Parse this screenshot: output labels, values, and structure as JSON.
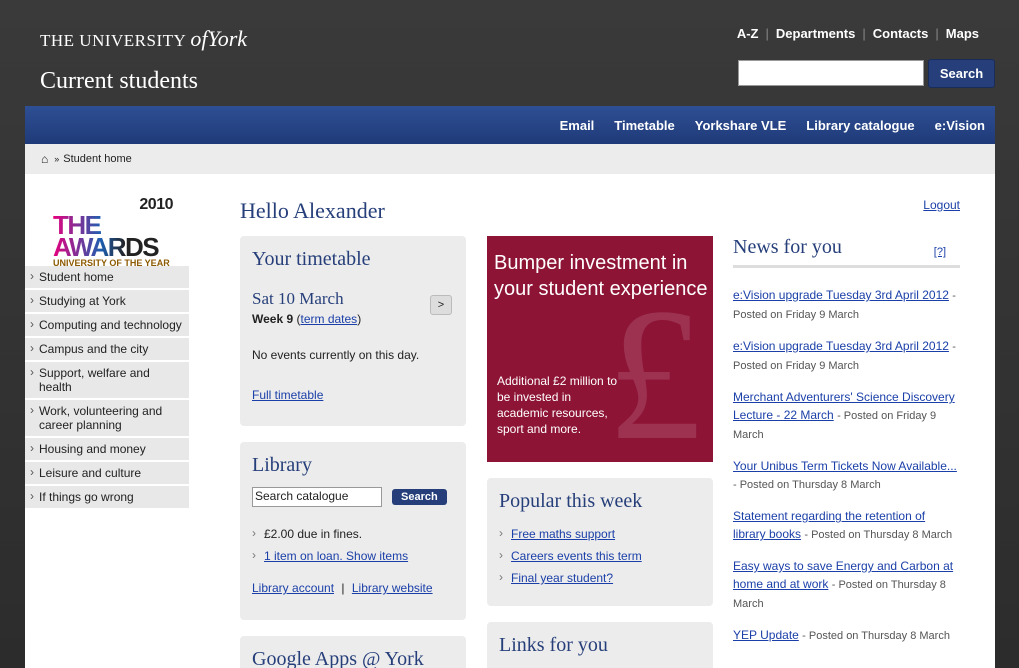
{
  "header": {
    "logo_prefix": "THE UNIVERSITY",
    "logo_of": "of",
    "logo_york": "York",
    "site_title": "Current students",
    "toplinks": [
      "A-Z",
      "Departments",
      "Contacts",
      "Maps"
    ],
    "search_button": "Search"
  },
  "nav": [
    "Email",
    "Timetable",
    "Yorkshare VLE",
    "Library catalogue",
    "e:Vision"
  ],
  "breadcrumb": {
    "home_icon": "home-icon",
    "separator": "»",
    "current": "Student home"
  },
  "awards": {
    "year": "2010",
    "word": "THE AWARDS",
    "sub": "UNIVERSITY OF THE YEAR"
  },
  "sidebar": [
    "Student home",
    "Studying at York",
    "Computing and technology",
    "Campus and the city",
    "Support, welfare and health",
    "Work, volunteering and career planning",
    "Housing and money",
    "Leisure and culture",
    "If things go wrong"
  ],
  "greeting": "Hello Alexander",
  "logout": "Logout",
  "timetable": {
    "title": "Your timetable",
    "date": "Sat 10 March",
    "next": ">",
    "week": "Week 9",
    "term_dates": "term dates",
    "no_events": "No events currently on this day.",
    "full": "Full timetable"
  },
  "library": {
    "title": "Library",
    "placeholder": "Search catalogue",
    "search": "Search",
    "fines": "£2.00 due in fines.",
    "loan": "1 item on loan. Show items",
    "account": "Library account",
    "website": "Library website"
  },
  "google": {
    "title": "Google Apps @ York"
  },
  "promo": {
    "headline": "Bumper investment in your student experience",
    "body": "Additional £2 million to be invested in academic resources, sport and more.",
    "symbol": "£"
  },
  "popular": {
    "title": "Popular this week",
    "items": [
      "Free maths support",
      "Careers events this term",
      "Final year student?"
    ]
  },
  "links": {
    "title": "Links for you"
  },
  "news": {
    "title": "News for you",
    "help": "[?]",
    "items": [
      {
        "title": "e:Vision upgrade Tuesday 3rd April 2012",
        "meta": "- Posted on Friday 9 March"
      },
      {
        "title": "e:Vision upgrade Tuesday 3rd April 2012",
        "meta": "- Posted on Friday 9 March"
      },
      {
        "title": "Merchant Adventurers' Science Discovery Lecture - 22 March",
        "meta": "- Posted on Friday 9 March"
      },
      {
        "title": "Your Unibus Term Tickets Now Available...",
        "meta": "- Posted on Thursday 8 March"
      },
      {
        "title": "Statement regarding the retention of library books",
        "meta": "- Posted on Thursday 8 March"
      },
      {
        "title": "Easy ways to save Energy and Carbon at home and at work",
        "meta": "- Posted on Thursday 8 March"
      },
      {
        "title": "YEP Update",
        "meta": "- Posted on Thursday 8 March"
      }
    ]
  }
}
